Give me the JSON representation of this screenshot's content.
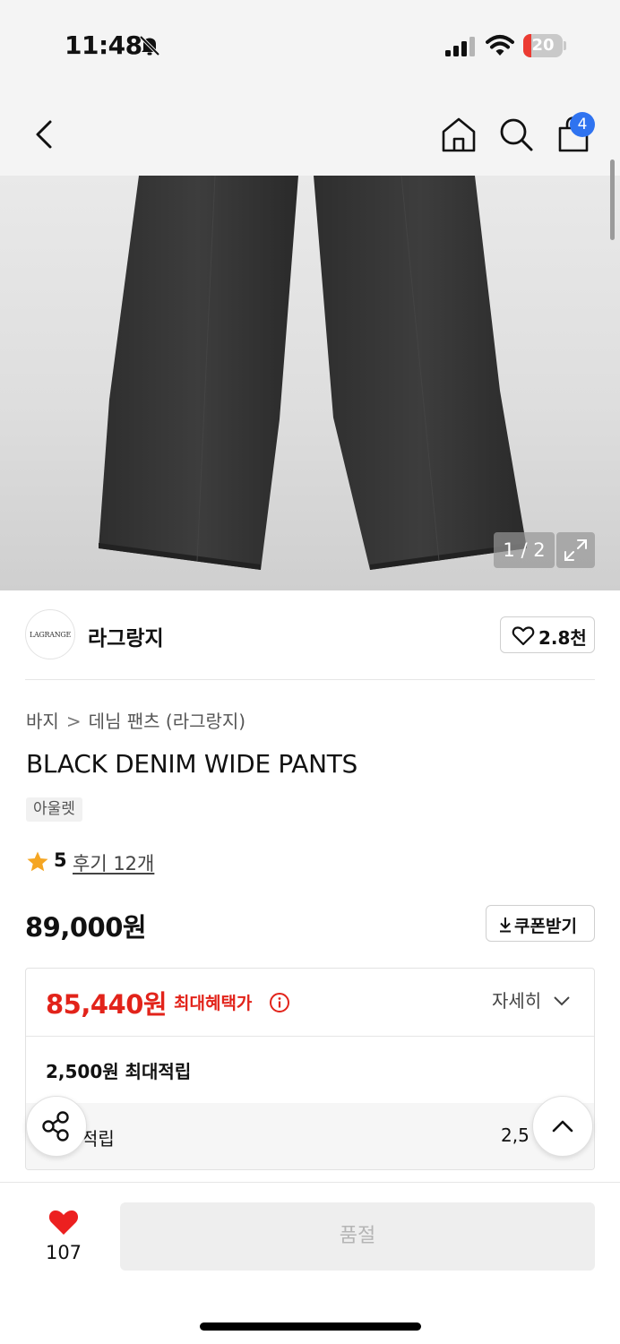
{
  "status_bar": {
    "time": "11:48",
    "battery": "20",
    "battery_level": 0.2,
    "icons": [
      "bell-off-icon",
      "signal-icon",
      "wifi-icon",
      "battery-icon"
    ]
  },
  "header": {
    "icons": [
      "chevron-left-icon",
      "home-icon",
      "search-icon",
      "shopping-bag-icon"
    ],
    "cart_count": "4"
  },
  "gallery": {
    "counter": "1 / 2",
    "icons": [
      "expand-icon"
    ]
  },
  "brand": {
    "logo_text": "LAGRANGE",
    "name": "라그랑지",
    "like_count": "2.8천"
  },
  "product": {
    "breadcrumb": [
      "바지",
      "데님 팬츠 (라그랑지)"
    ],
    "title": "BLACK DENIM WIDE PANTS",
    "tag": "아울렛",
    "rating": "5",
    "reviews": "후기 12개",
    "price": "89,000원",
    "coupon_label": "쿠폰받기"
  },
  "benefit": {
    "price": "85,440원",
    "label": "최대혜택가",
    "detail_toggle": "자세히",
    "points_max": "2,500원 최대적립",
    "points_row_label": "적립",
    "points_row_value": "2,5"
  },
  "bottom_bar": {
    "wish_count": "107",
    "soldout_label": "품절"
  },
  "colors": {
    "accent_red": "#e2231a",
    "badge_blue": "#2f73f0",
    "star_orange": "#f5a623",
    "battery_red": "#ec3b32"
  }
}
